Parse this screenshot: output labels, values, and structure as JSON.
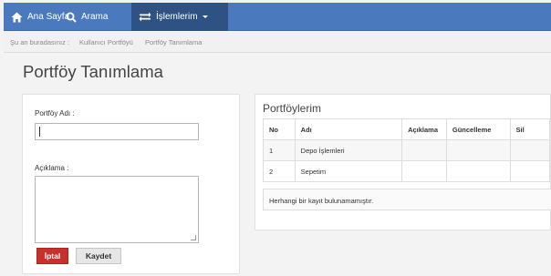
{
  "navbar": {
    "home_label": "Ana Sayfa",
    "search_label": "Arama",
    "operations_label": "İşlemlerim"
  },
  "breadcrumb": {
    "prefix": "Şu an buradasınız :",
    "items": [
      "Kullanıcı Portföyü",
      "Portföy Tanımlama"
    ]
  },
  "page": {
    "title": "Portföy Tanımlama"
  },
  "form": {
    "name_label": "Portföy Adı :",
    "name_value": "",
    "description_label": "Açıklama :",
    "description_value": "",
    "cancel_label": "İptal",
    "save_label": "Kaydet"
  },
  "portfolios": {
    "title": "Portföylerim",
    "columns": [
      "No",
      "Adı",
      "Açıklama",
      "Güncelleme",
      "Sil"
    ],
    "rows": [
      {
        "no": "1",
        "name": "Depo İşlemleri",
        "description": "",
        "update": "",
        "delete": ""
      },
      {
        "no": "2",
        "name": "Sepetim",
        "description": "",
        "update": "",
        "delete": ""
      }
    ],
    "empty_message": "Herhangi bir kayıt bulunamamıştır."
  },
  "colors": {
    "navbar": "#4b79bd",
    "navbar_active": "#2e5284",
    "cancel_button": "#c9302c"
  }
}
